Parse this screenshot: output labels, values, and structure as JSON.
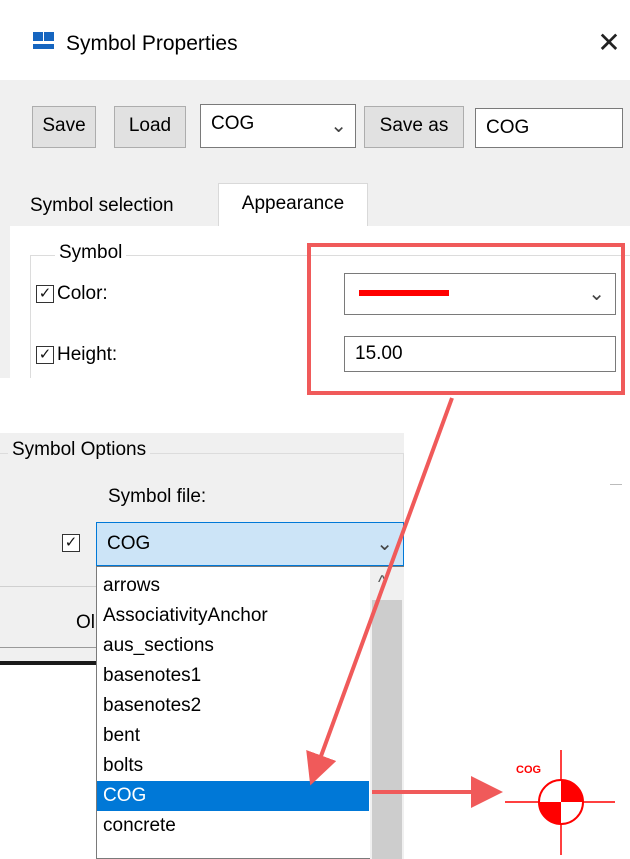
{
  "window": {
    "title": "Symbol Properties",
    "close_glyph": "✕"
  },
  "toolbar": {
    "save_label": "Save",
    "load_label": "Load",
    "preset_value": "COG",
    "save_as_label": "Save as",
    "save_as_value": "COG"
  },
  "tabs": [
    {
      "label": "Symbol selection",
      "active": false
    },
    {
      "label": "Appearance",
      "active": true
    }
  ],
  "symbol_group": {
    "legend": "Symbol",
    "color_label": "Color:",
    "color_checked": true,
    "color_value": "#ff0000",
    "height_label": "Height:",
    "height_checked": true,
    "height_value": "15.00"
  },
  "symbol_options": {
    "legend": "Symbol Options",
    "file_label": "Symbol file:",
    "file_checked": true,
    "file_value": "COG",
    "partial_button_label": "Ol",
    "options": [
      "arrows",
      "AssociativityAnchor",
      "aus_sections",
      "basenotes1",
      "basenotes2",
      "bent",
      "bolts",
      "COG",
      "concrete"
    ],
    "selected_index": 7
  },
  "preview": {
    "symbol_text": "COG"
  },
  "colors": {
    "highlight": "#f05a5a",
    "selection": "#0078d7",
    "symbol_red": "#ff0000"
  }
}
